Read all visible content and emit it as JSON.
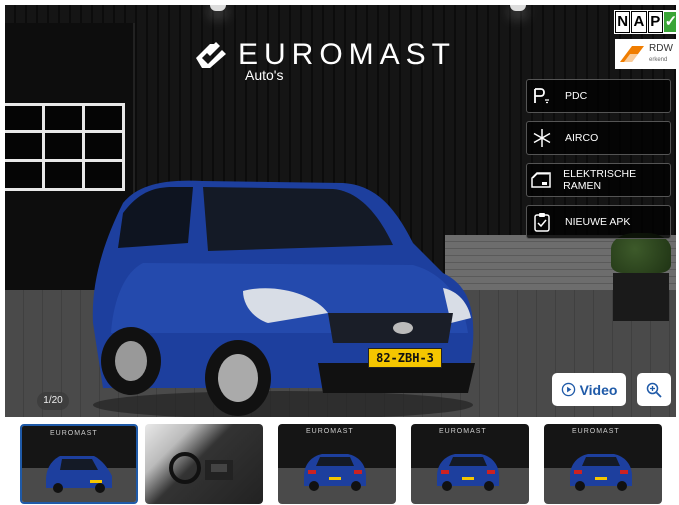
{
  "brand": {
    "name": "EUROMAST",
    "sub": "Auto's"
  },
  "badges": {
    "nap": [
      "N",
      "A",
      "P"
    ],
    "rdw_name": "RDW",
    "rdw_sub": "erkend"
  },
  "features": [
    {
      "icon": "parking-sensor-icon",
      "label": "PDC"
    },
    {
      "icon": "snowflake-icon",
      "label": "AIRCO"
    },
    {
      "icon": "car-window-icon",
      "label": "ELEKTRISCHE RAMEN"
    },
    {
      "icon": "clipboard-check-icon",
      "label": "NIEUWE APK"
    }
  ],
  "car": {
    "plate": "82-ZBH-3",
    "color": "#1d3f9e"
  },
  "gallery": {
    "counter": "1/20",
    "video_label": "Video",
    "active_index": 0,
    "thumbnail_count": 5
  },
  "colors": {
    "accent": "#1f5aa8",
    "car_blue": "#1d3f9e",
    "nap_green": "#3aa537",
    "rdw_orange": "#f07d00"
  }
}
